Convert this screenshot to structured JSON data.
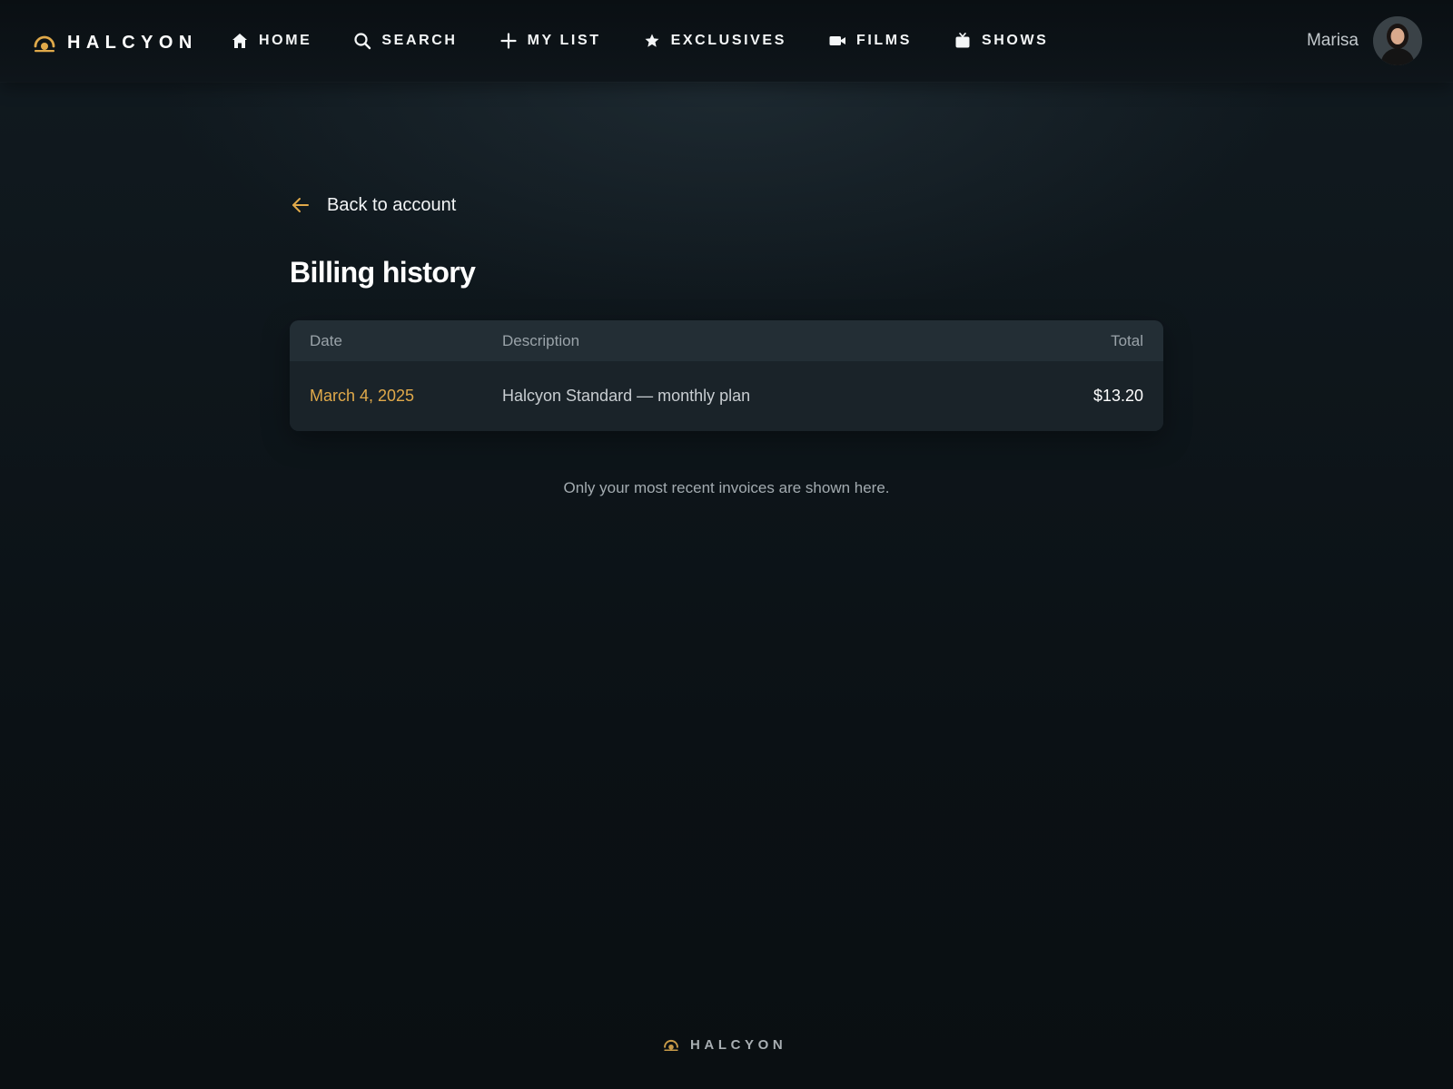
{
  "app": {
    "brand": "HALCYON",
    "accent_color": "#e0a94a"
  },
  "nav": {
    "items": [
      {
        "label": "HOME",
        "icon": "home-icon"
      },
      {
        "label": "SEARCH",
        "icon": "search-icon"
      },
      {
        "label": "MY LIST",
        "icon": "plus-icon"
      },
      {
        "label": "EXCLUSIVES",
        "icon": "star-icon"
      },
      {
        "label": "FILMS",
        "icon": "video-camera-icon"
      },
      {
        "label": "SHOWS",
        "icon": "tv-icon"
      }
    ]
  },
  "user": {
    "name": "Marisa",
    "avatar": "avatar"
  },
  "main": {
    "back_label": "Back to account",
    "back_icon": "arrow-left-icon",
    "title": "Billing history",
    "table": {
      "columns": [
        "Date",
        "Description",
        "Total"
      ],
      "rows": [
        {
          "date": "March 4, 2025",
          "description": "Halcyon Standard — monthly plan",
          "total": "$13.20"
        }
      ]
    },
    "note": "Only your most recent invoices are shown here."
  },
  "footer": {
    "brand": "HALCYON"
  }
}
